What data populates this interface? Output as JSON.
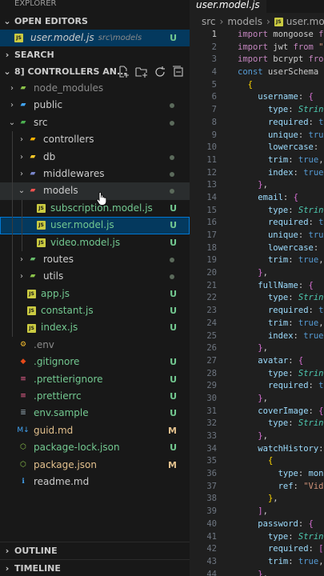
{
  "sidebar": {
    "explorer_label": "EXPLORER",
    "open_editors": {
      "title": "OPEN EDITORS",
      "item": {
        "icon": "JS",
        "name": "user.model.js",
        "path": "src\\models",
        "status": "U"
      }
    },
    "search_title": "SEARCH",
    "workspace_title": "8] CONTROLLERS AN...",
    "tree": [
      {
        "label": "node_modules",
        "type": "folder",
        "level": 1,
        "icon": "folder-node-icon",
        "dim": true
      },
      {
        "label": "public",
        "type": "folder",
        "level": 1,
        "icon": "folder-public-icon",
        "dot": true
      },
      {
        "label": "src",
        "type": "folder-open",
        "level": 1,
        "icon": "folder-src-icon",
        "dot": true
      },
      {
        "label": "controllers",
        "type": "folder",
        "level": 2,
        "icon": "folder-controllers-icon"
      },
      {
        "label": "db",
        "type": "folder",
        "level": 2,
        "icon": "folder-db-icon",
        "dot": true
      },
      {
        "label": "middlewares",
        "type": "folder",
        "level": 2,
        "icon": "folder-middlewares-icon",
        "dot": true
      },
      {
        "label": "models",
        "type": "folder-open",
        "level": 2,
        "icon": "folder-models-icon",
        "dot": true,
        "hover": true
      },
      {
        "label": "subscription.model.js",
        "type": "file",
        "level": 3,
        "icon": "js-icon",
        "status": "U"
      },
      {
        "label": "user.model.js",
        "type": "file",
        "level": 3,
        "icon": "js-icon",
        "status": "U",
        "selected": true
      },
      {
        "label": "video.model.js",
        "type": "file",
        "level": 3,
        "icon": "js-icon",
        "status": "U"
      },
      {
        "label": "routes",
        "type": "folder",
        "level": 2,
        "icon": "folder-routes-icon",
        "dot": true
      },
      {
        "label": "utils",
        "type": "folder",
        "level": 2,
        "icon": "folder-utils-icon",
        "dot": true
      },
      {
        "label": "app.js",
        "type": "file",
        "level": 2,
        "icon": "js-icon",
        "status": "U"
      },
      {
        "label": "constant.js",
        "type": "file",
        "level": 2,
        "icon": "js-icon",
        "status": "U"
      },
      {
        "label": "index.js",
        "type": "file",
        "level": 2,
        "icon": "js-icon",
        "status": "U"
      },
      {
        "label": ".env",
        "type": "file",
        "level": 1,
        "icon": "env-icon",
        "dim": true
      },
      {
        "label": ".gitignore",
        "type": "file",
        "level": 1,
        "icon": "git-icon",
        "status": "U"
      },
      {
        "label": ".prettierignore",
        "type": "file",
        "level": 1,
        "icon": "prettier-icon",
        "status": "U"
      },
      {
        "label": ".prettierrc",
        "type": "file",
        "level": 1,
        "icon": "prettier-icon",
        "status": "U"
      },
      {
        "label": "env.sample",
        "type": "file",
        "level": 1,
        "icon": "text-file-icon",
        "status": "U"
      },
      {
        "label": "guid.md",
        "type": "file",
        "level": 1,
        "icon": "markdown-icon",
        "status": "M"
      },
      {
        "label": "package-lock.json",
        "type": "file",
        "level": 1,
        "icon": "node-json-icon",
        "status": "U"
      },
      {
        "label": "package.json",
        "type": "file",
        "level": 1,
        "icon": "node-json-icon",
        "status": "M"
      },
      {
        "label": "readme.md",
        "type": "file",
        "level": 1,
        "icon": "info-icon"
      }
    ],
    "outline_title": "OUTLINE",
    "timeline_title": "TIMELINE"
  },
  "editor": {
    "tab_label": "user.model.js",
    "breadcrumb": [
      "src",
      "models",
      "user.model.js"
    ],
    "current_line": 1,
    "lines": [
      [
        [
          "kw",
          "import"
        ],
        [
          "pn",
          " mongoose "
        ],
        [
          "kw",
          "f"
        ]
      ],
      [
        [
          "kw",
          "import"
        ],
        [
          "pn",
          " jwt "
        ],
        [
          "kw",
          "from"
        ],
        [
          "st",
          " \""
        ]
      ],
      [
        [
          "kw",
          "import"
        ],
        [
          "pn",
          " bcrypt "
        ],
        [
          "kw",
          "fro"
        ]
      ],
      [
        [
          "kb",
          "const"
        ],
        [
          "pn",
          " userSchema"
        ]
      ],
      [
        [
          "pn",
          "  "
        ],
        [
          "by",
          "{"
        ]
      ],
      [
        [
          "pn",
          "    "
        ],
        [
          "pr",
          "username"
        ],
        [
          "pn",
          ": "
        ],
        [
          "br",
          "{"
        ]
      ],
      [
        [
          "pn",
          "      "
        ],
        [
          "pr",
          "type"
        ],
        [
          "pn",
          ": "
        ],
        [
          "ty",
          "Strin"
        ]
      ],
      [
        [
          "pn",
          "      "
        ],
        [
          "pr",
          "required"
        ],
        [
          "pn",
          ": "
        ],
        [
          "tr",
          "t"
        ]
      ],
      [
        [
          "pn",
          "      "
        ],
        [
          "pr",
          "unique"
        ],
        [
          "pn",
          ": "
        ],
        [
          "tr",
          "tru"
        ]
      ],
      [
        [
          "pn",
          "      "
        ],
        [
          "pr",
          "lowercase"
        ],
        [
          "pn",
          ": "
        ]
      ],
      [
        [
          "pn",
          "      "
        ],
        [
          "pr",
          "trim"
        ],
        [
          "pn",
          ": "
        ],
        [
          "tr",
          "true"
        ],
        [
          "pn",
          ","
        ]
      ],
      [
        [
          "pn",
          "      "
        ],
        [
          "pr",
          "index"
        ],
        [
          "pn",
          ": "
        ],
        [
          "tr",
          "true"
        ]
      ],
      [
        [
          "pn",
          "    "
        ],
        [
          "br",
          "}"
        ],
        [
          "pn",
          ","
        ]
      ],
      [
        [
          "pn",
          "    "
        ],
        [
          "pr",
          "email"
        ],
        [
          "pn",
          ": "
        ],
        [
          "br",
          "{"
        ]
      ],
      [
        [
          "pn",
          "      "
        ],
        [
          "pr",
          "type"
        ],
        [
          "pn",
          ": "
        ],
        [
          "ty",
          "Strin"
        ]
      ],
      [
        [
          "pn",
          "      "
        ],
        [
          "pr",
          "required"
        ],
        [
          "pn",
          ": "
        ],
        [
          "tr",
          "t"
        ]
      ],
      [
        [
          "pn",
          "      "
        ],
        [
          "pr",
          "unique"
        ],
        [
          "pn",
          ": "
        ],
        [
          "tr",
          "tru"
        ]
      ],
      [
        [
          "pn",
          "      "
        ],
        [
          "pr",
          "lowercase"
        ],
        [
          "pn",
          ": "
        ]
      ],
      [
        [
          "pn",
          "      "
        ],
        [
          "pr",
          "trim"
        ],
        [
          "pn",
          ": "
        ],
        [
          "tr",
          "true"
        ],
        [
          "pn",
          ","
        ]
      ],
      [
        [
          "pn",
          "    "
        ],
        [
          "br",
          "}"
        ],
        [
          "pn",
          ","
        ]
      ],
      [
        [
          "pn",
          "    "
        ],
        [
          "pr",
          "fullName"
        ],
        [
          "pn",
          ": "
        ],
        [
          "br",
          "{"
        ]
      ],
      [
        [
          "pn",
          "      "
        ],
        [
          "pr",
          "type"
        ],
        [
          "pn",
          ": "
        ],
        [
          "ty",
          "Strin"
        ]
      ],
      [
        [
          "pn",
          "      "
        ],
        [
          "pr",
          "required"
        ],
        [
          "pn",
          ": "
        ],
        [
          "tr",
          "t"
        ]
      ],
      [
        [
          "pn",
          "      "
        ],
        [
          "pr",
          "trim"
        ],
        [
          "pn",
          ": "
        ],
        [
          "tr",
          "true"
        ],
        [
          "pn",
          ","
        ]
      ],
      [
        [
          "pn",
          "      "
        ],
        [
          "pr",
          "index"
        ],
        [
          "pn",
          ": "
        ],
        [
          "tr",
          "true"
        ]
      ],
      [
        [
          "pn",
          "    "
        ],
        [
          "br",
          "}"
        ],
        [
          "pn",
          ","
        ]
      ],
      [
        [
          "pn",
          "    "
        ],
        [
          "pr",
          "avatar"
        ],
        [
          "pn",
          ": "
        ],
        [
          "br",
          "{"
        ]
      ],
      [
        [
          "pn",
          "      "
        ],
        [
          "pr",
          "type"
        ],
        [
          "pn",
          ": "
        ],
        [
          "ty",
          "Strin"
        ]
      ],
      [
        [
          "pn",
          "      "
        ],
        [
          "pr",
          "required"
        ],
        [
          "pn",
          ": "
        ],
        [
          "tr",
          "t"
        ]
      ],
      [
        [
          "pn",
          "    "
        ],
        [
          "br",
          "}"
        ],
        [
          "pn",
          ","
        ]
      ],
      [
        [
          "pn",
          "    "
        ],
        [
          "pr",
          "coverImage"
        ],
        [
          "pn",
          ": "
        ],
        [
          "br",
          "{"
        ]
      ],
      [
        [
          "pn",
          "      "
        ],
        [
          "pr",
          "type"
        ],
        [
          "pn",
          ": "
        ],
        [
          "ty",
          "Strin"
        ]
      ],
      [
        [
          "pn",
          "    "
        ],
        [
          "br",
          "}"
        ],
        [
          "pn",
          ","
        ]
      ],
      [
        [
          "pn",
          "    "
        ],
        [
          "pr",
          "watchHistory"
        ],
        [
          "pn",
          ":"
        ]
      ],
      [
        [
          "pn",
          "      "
        ],
        [
          "by",
          "{"
        ]
      ],
      [
        [
          "pn",
          "        "
        ],
        [
          "pr",
          "type"
        ],
        [
          "pn",
          ": "
        ],
        [
          "pr",
          "mon"
        ]
      ],
      [
        [
          "pn",
          "        "
        ],
        [
          "pr",
          "ref"
        ],
        [
          "pn",
          ": "
        ],
        [
          "st",
          "\"Vid"
        ]
      ],
      [
        [
          "pn",
          "      "
        ],
        [
          "by",
          "}"
        ],
        [
          "pn",
          ","
        ]
      ],
      [
        [
          "pn",
          "    "
        ],
        [
          "br",
          "]"
        ],
        [
          "pn",
          ","
        ]
      ],
      [
        [
          "pn",
          "    "
        ],
        [
          "pr",
          "password"
        ],
        [
          "pn",
          ": "
        ],
        [
          "br",
          "{"
        ]
      ],
      [
        [
          "pn",
          "      "
        ],
        [
          "pr",
          "type"
        ],
        [
          "pn",
          ": "
        ],
        [
          "ty",
          "Strin"
        ]
      ],
      [
        [
          "pn",
          "      "
        ],
        [
          "pr",
          "required"
        ],
        [
          "pn",
          ": "
        ],
        [
          "br",
          "["
        ]
      ],
      [
        [
          "pn",
          "      "
        ],
        [
          "pr",
          "trim"
        ],
        [
          "pn",
          ": "
        ],
        [
          "tr",
          "true"
        ],
        [
          "pn",
          ","
        ]
      ],
      [
        [
          "pn",
          "    "
        ],
        [
          "br",
          "}"
        ],
        [
          "pn",
          ","
        ]
      ]
    ]
  },
  "colors": {
    "git_untracked": "#73c991",
    "git_modified": "#e2c08d",
    "accent": "#0078d4"
  }
}
